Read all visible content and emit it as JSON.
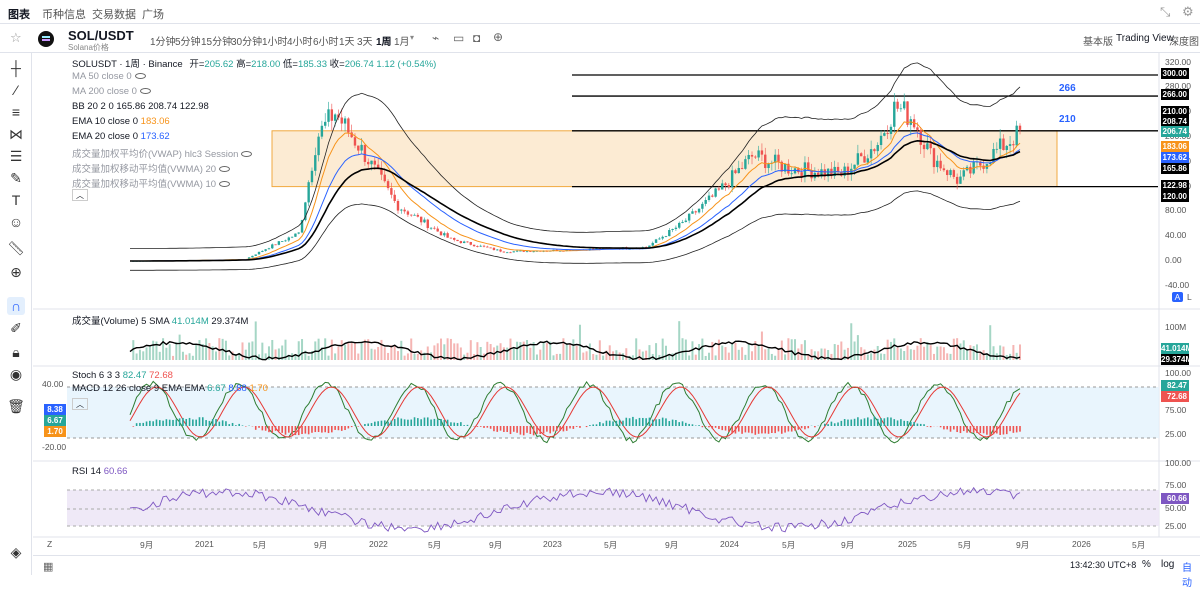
{
  "nav": {
    "tabs": [
      "图表",
      "币种信息",
      "交易数据",
      "广场"
    ]
  },
  "toolbar": {
    "intervals": [
      "1分钟",
      "5分钟",
      "15分钟",
      "30分钟",
      "1小时",
      "4小时",
      "6小时",
      "1天",
      "3天",
      "1周",
      "1月"
    ],
    "active_interval": "1周",
    "right_items": [
      "基本版",
      "Trading View",
      "深度图"
    ]
  },
  "symbol": {
    "name": "SOL/USDT",
    "subtitle": "Solana价格"
  },
  "legend": {
    "main_prefix": "SOLUSDT · 1周 · Binance",
    "open_label": "开=",
    "open": "205.62",
    "high_label": "高=",
    "high": "218.00",
    "low_label": "低=",
    "low": "185.33",
    "close_label": "收=",
    "close": "206.74",
    "change": "1.12 (+0.54%)",
    "ma50": "MA 50 close 0",
    "ma200": "MA 200 close 0",
    "bb_name": "BB 20 2 0",
    "bb_values": "165.86  208.74  122.98",
    "ema10_name": "EMA 10 close 0",
    "ema10_value": "183.06",
    "ema20_name": "EMA 20 close 0",
    "ema20_value": "173.62",
    "vwap": "成交量加权平均价(VWAP) hlc3 Session",
    "vwma20": "成交量加权移动平均值(VWMA) 20",
    "vwma10": "成交量加权移动平均值(VWMA) 10",
    "volume_name": "成交量(Volume) 5 SMA",
    "volume_v1": "41.014M",
    "volume_v2": "29.374M",
    "stoch_name": "Stoch 6 3 3",
    "stoch_k": "82.47",
    "stoch_d": "72.68",
    "macd_name": "MACD 12 26 close 9 EMA EMA",
    "macd_v1": "6.67",
    "macd_v2": "8.88",
    "macd_v3": "1.70",
    "rsi_name": "RSI 14",
    "rsi_value": "60.66"
  },
  "price_axis": [
    "320.00",
    "280.00",
    "240.00",
    "200.00",
    "160.00",
    "120.00",
    "80.00",
    "40.00",
    "0.00",
    "-40.00"
  ],
  "price_badges": [
    {
      "label": "300.00",
      "color": "#000000"
    },
    {
      "label": "266.00",
      "color": "#000000"
    },
    {
      "label": "210.00",
      "color": "#000000"
    },
    {
      "label": "208.74",
      "color": "#000000"
    },
    {
      "label": "206.74",
      "color": "#26a69a"
    },
    {
      "label": "183.06",
      "color": "#f7931a"
    },
    {
      "label": "173.62",
      "color": "#2962ff"
    },
    {
      "label": "165.86",
      "color": "#000000"
    },
    {
      "label": "122.98",
      "color": "#000000"
    },
    {
      "label": "120.00",
      "color": "#000000"
    }
  ],
  "levels": {
    "l266": "266",
    "l210": "210"
  },
  "volume_axis": [
    "100M",
    "50M"
  ],
  "volume_badges": [
    {
      "label": "41.014M",
      "color": "#26a69a"
    },
    {
      "label": "29.374M",
      "color": "#000000"
    }
  ],
  "stoch_axis": [
    "100.00",
    "75.00",
    "50.00",
    "25.00"
  ],
  "stoch_badges": [
    {
      "label": "82.47",
      "color": "#26a69a"
    },
    {
      "label": "72.68",
      "color": "#ef5350"
    }
  ],
  "macd_axis": [
    "40.00",
    "-20.00"
  ],
  "macd_badges": [
    {
      "label": "8.38",
      "color": "#2962ff"
    },
    {
      "label": "6.67",
      "color": "#26a69a"
    },
    {
      "label": "1.70",
      "color": "#f7931a"
    }
  ],
  "rsi_axis": [
    "100.00",
    "75.00",
    "50.00",
    "25.00"
  ],
  "rsi_badge": {
    "label": "60.66",
    "color": "#7e57c2"
  },
  "time_axis": [
    "9月",
    "2021",
    "5月",
    "9月",
    "2022",
    "5月",
    "9月",
    "2023",
    "5月",
    "9月",
    "2024",
    "5月",
    "9月",
    "2025",
    "5月",
    "9月",
    "2026",
    "5月"
  ],
  "bottom": {
    "clock": "13:42:30 UTC+8",
    "percent": "%",
    "log": "log",
    "auto": "自动"
  },
  "scale_buttons": [
    "A",
    "L"
  ],
  "colors": {
    "up": "#26a69a",
    "down": "#ef5350",
    "zone": "#fbe3c0",
    "ema10": "#f7931a",
    "ema20": "#2962ff",
    "accent": "#2962ff"
  }
}
